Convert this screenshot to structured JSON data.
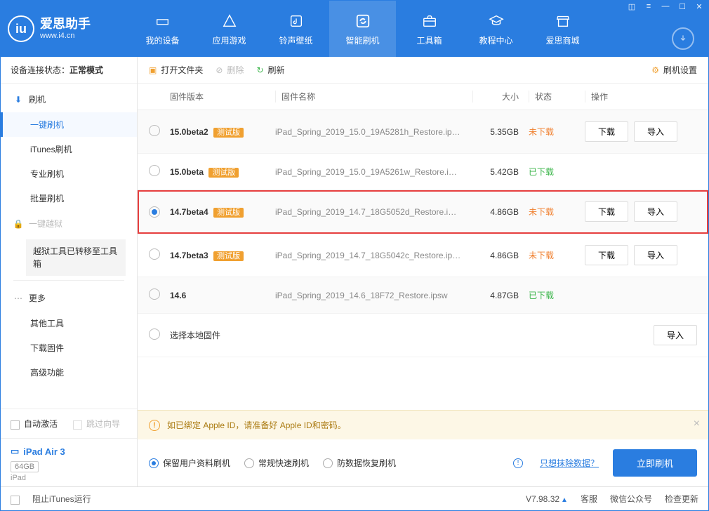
{
  "brand": {
    "title": "爱思助手",
    "subtitle": "www.i4.cn"
  },
  "nav": [
    {
      "label": "我的设备"
    },
    {
      "label": "应用游戏"
    },
    {
      "label": "铃声壁纸"
    },
    {
      "label": "智能刷机"
    },
    {
      "label": "工具箱"
    },
    {
      "label": "教程中心"
    },
    {
      "label": "爱思商城"
    }
  ],
  "status": {
    "prefix": "设备连接状态：",
    "value": "正常模式"
  },
  "side": {
    "flash": "刷机",
    "subs": [
      "一键刷机",
      "iTunes刷机",
      "专业刷机",
      "批量刷机"
    ],
    "jailbreak": "一键越狱",
    "jbnote": "越狱工具已转移至工具箱",
    "more": "更多",
    "moreSubs": [
      "其他工具",
      "下载固件",
      "高级功能"
    ]
  },
  "checks": {
    "auto": "自动激活",
    "skip": "跳过向导",
    "block": "阻止iTunes运行"
  },
  "device": {
    "name": "iPad Air 3",
    "storage": "64GB",
    "type": "iPad"
  },
  "toolbar": {
    "open": "打开文件夹",
    "delete": "删除",
    "refresh": "刷新",
    "settings": "刷机设置"
  },
  "columns": {
    "ver": "固件版本",
    "name": "固件名称",
    "size": "大小",
    "stat": "状态",
    "act": "操作"
  },
  "badges": {
    "beta": "测试版"
  },
  "statuses": {
    "nd": "未下载",
    "dl": "已下载"
  },
  "actions": {
    "download": "下载",
    "import": "导入"
  },
  "rows": [
    {
      "ver": "15.0beta2",
      "beta": true,
      "name": "iPad_Spring_2019_15.0_19A5281h_Restore.ip…",
      "size": "5.35GB",
      "stat": "nd",
      "selected": false,
      "dlbtn": true
    },
    {
      "ver": "15.0beta",
      "beta": true,
      "name": "iPad_Spring_2019_15.0_19A5261w_Restore.i…",
      "size": "5.42GB",
      "stat": "dl",
      "selected": false,
      "dlbtn": false
    },
    {
      "ver": "14.7beta4",
      "beta": true,
      "name": "iPad_Spring_2019_14.7_18G5052d_Restore.i…",
      "size": "4.86GB",
      "stat": "nd",
      "selected": true,
      "dlbtn": true,
      "highlight": true
    },
    {
      "ver": "14.7beta3",
      "beta": true,
      "name": "iPad_Spring_2019_14.7_18G5042c_Restore.ip…",
      "size": "4.86GB",
      "stat": "nd",
      "selected": false,
      "dlbtn": true
    },
    {
      "ver": "14.6",
      "beta": false,
      "name": "iPad_Spring_2019_14.6_18F72_Restore.ipsw",
      "size": "4.87GB",
      "stat": "dl",
      "selected": false,
      "dlbtn": false
    }
  ],
  "localRow": "选择本地固件",
  "notice": "如已绑定 Apple ID，请准备好 Apple ID和密码。",
  "opts": [
    "保留用户资料刷机",
    "常规快速刷机",
    "防数据恢复刷机"
  ],
  "eraseLink": "只想抹除数据？",
  "flashNow": "立即刷机",
  "footer": {
    "version": "V7.98.32",
    "service": "客服",
    "wechat": "微信公众号",
    "update": "检查更新"
  }
}
